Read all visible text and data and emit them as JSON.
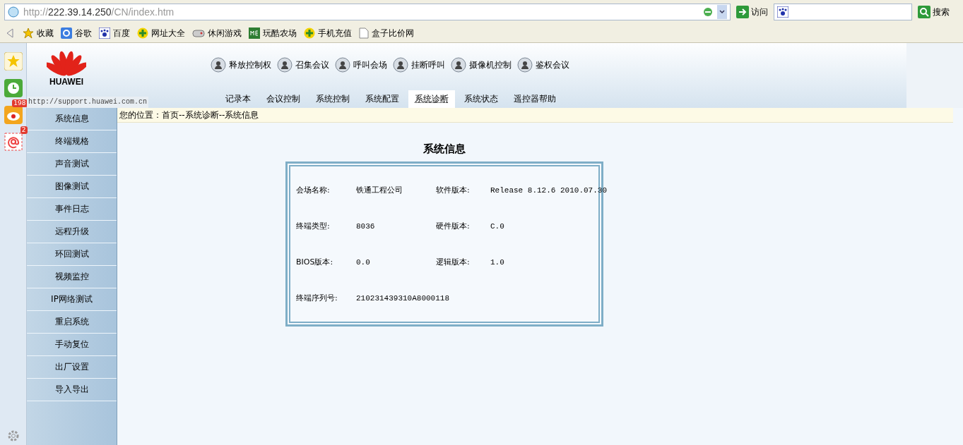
{
  "browser": {
    "url": {
      "scheme": "http://",
      "host": "222.39.14.250",
      "path": "/CN/index.htm"
    },
    "go_button": "访问",
    "search_button": "搜索",
    "bookmarks": [
      {
        "kind": "star",
        "label": "收藏"
      },
      {
        "kind": "google",
        "label": "谷歌"
      },
      {
        "kind": "paw",
        "label": "百度"
      },
      {
        "kind": "plus",
        "label": "网址大全"
      },
      {
        "kind": "gamepad",
        "label": "休闲游戏"
      },
      {
        "kind": "me",
        "label": "玩酷农场"
      },
      {
        "kind": "plus",
        "label": "手机充值"
      },
      {
        "kind": "page",
        "label": "盒子比价网"
      }
    ]
  },
  "dock": [
    {
      "kind": "star"
    },
    {
      "kind": "clock"
    },
    {
      "kind": "eye",
      "badge": "198"
    },
    {
      "kind": "mail",
      "badge": "2"
    }
  ],
  "header": {
    "logo": "HUAWEI",
    "support_url": "http://support.huawei.com.cn",
    "actions": [
      "释放控制权",
      "召集会议",
      "呼叫会场",
      "挂断呼叫",
      "摄像机控制",
      "鉴权会议"
    ],
    "tabs": [
      {
        "label": "记录本",
        "selected": false
      },
      {
        "label": "会议控制",
        "selected": false
      },
      {
        "label": "系统控制",
        "selected": false
      },
      {
        "label": "系统配置",
        "selected": false
      },
      {
        "label": "系统诊断",
        "selected": true
      },
      {
        "label": "系统状态",
        "selected": false
      },
      {
        "label": "遥控器帮助",
        "selected": false
      }
    ]
  },
  "sidebar": {
    "items": [
      "系统信息",
      "终端规格",
      "声音测试",
      "图像测试",
      "事件日志",
      "远程升级",
      "环回测试",
      "视频监控",
      "IP网络测试",
      "重启系统",
      "手动复位",
      "出厂设置",
      "导入导出"
    ]
  },
  "breadcrumb": "您的位置：首页--系统诊断--系统信息",
  "panel": {
    "title": "系统信息",
    "rows": [
      [
        {
          "label": "会场名称:",
          "value": "铁通工程公司"
        },
        {
          "label": "软件版本:",
          "value": "Release 8.12.6 2010.07.30"
        }
      ],
      [
        {
          "label": "终端类型:",
          "value": "8036"
        },
        {
          "label": "硬件版本:",
          "value": "C.0"
        }
      ],
      [
        {
          "label": "BIOS版本:",
          "value": "0.0"
        },
        {
          "label": "逻辑版本:",
          "value": "1.0"
        }
      ],
      [
        {
          "label": "终端序列号:",
          "value": "210231439310A8000118"
        }
      ]
    ]
  }
}
